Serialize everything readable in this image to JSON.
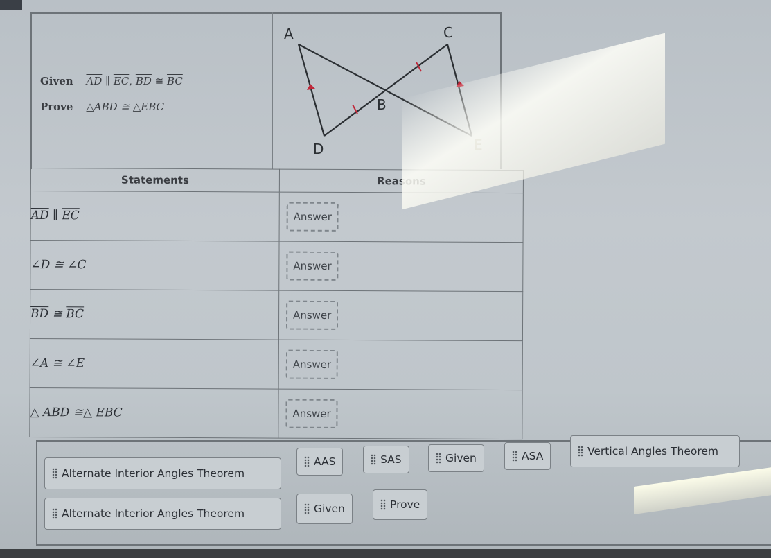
{
  "problem": {
    "given_label": "Given",
    "given_parts": {
      "s1": "AD",
      "rel1": "∥",
      "s2": "EC",
      "sep": ",",
      "s3": "BD",
      "rel2": "≅",
      "s4": "BC"
    },
    "prove_label": "Prove",
    "prove_statement": "△ABD ≅ △EBC"
  },
  "diagram": {
    "points": {
      "A": "A",
      "B": "B",
      "C": "C",
      "D": "D",
      "E": "E"
    },
    "marks_color": "#c0283a",
    "segments": [
      "AE",
      "DC",
      "AD",
      "CE"
    ],
    "parallel_marks": [
      "AD",
      "CE"
    ],
    "tick_marks": [
      "BD",
      "BC"
    ]
  },
  "table": {
    "headers": {
      "statements": "Statements",
      "reasons": "Reasons"
    },
    "rows": [
      {
        "statement": {
          "a": "AD",
          "rel": "∥",
          "b": "EC",
          "kind": "segment"
        },
        "reason": "Answer"
      },
      {
        "statement": {
          "text": "∠D ≅ ∠C",
          "kind": "text"
        },
        "reason": "Answer"
      },
      {
        "statement": {
          "a": "BD",
          "rel": "≅",
          "b": "BC",
          "kind": "segment"
        },
        "reason": "Answer"
      },
      {
        "statement": {
          "text": "∠A ≅ ∠E",
          "kind": "text"
        },
        "reason": "Answer"
      },
      {
        "statement": {
          "text": "△ ABD ≅△ EBC",
          "kind": "text"
        },
        "reason": "Answer"
      }
    ]
  },
  "answer_bank": {
    "row1": [
      "Alternate Interior Angles Theorem",
      "AAS",
      "SAS",
      "Given",
      "ASA",
      "Vertical Angles Theorem"
    ],
    "row2": [
      "Alternate Interior Angles Theorem",
      "Given",
      "Prove"
    ]
  }
}
